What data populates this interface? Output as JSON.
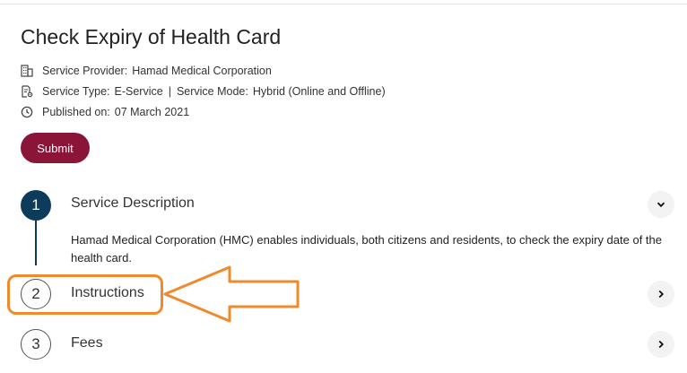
{
  "page": {
    "title": "Check Expiry of Health Card"
  },
  "meta": {
    "provider_label": "Service Provider:",
    "provider_value": "Hamad Medical Corporation",
    "type_label": "Service Type:",
    "type_value": "E-Service",
    "separator": "|",
    "mode_label": "Service Mode:",
    "mode_value": "Hybrid (Online and Offline)",
    "published_label": "Published on:",
    "published_value": "07 March 2021"
  },
  "actions": {
    "submit_label": "Submit"
  },
  "steps": [
    {
      "number": "1",
      "title": "Service Description",
      "expanded": true,
      "description": "Hamad Medical Corporation (HMC) enables individuals, both citizens and residents, to check the expiry date of the health card."
    },
    {
      "number": "2",
      "title": "Instructions",
      "expanded": false
    },
    {
      "number": "3",
      "title": "Fees",
      "expanded": false
    }
  ],
  "icons": {
    "provider": "building-icon",
    "type": "document-gear-icon",
    "published": "clock-icon",
    "expanded": "chevron-down-icon",
    "collapsed": "chevron-right-icon"
  },
  "colors": {
    "brand": "#8a1538",
    "step_active": "#0d3b5c",
    "annotation": "#f08a2c"
  }
}
